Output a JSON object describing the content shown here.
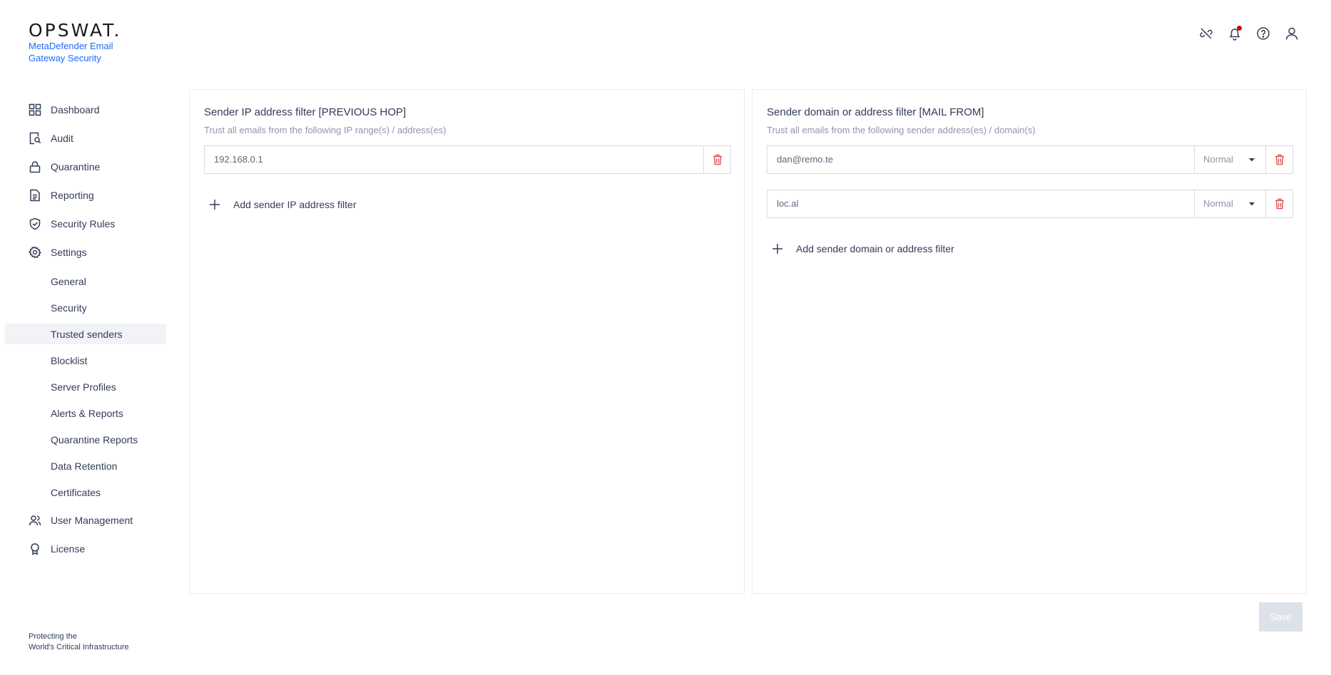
{
  "brand": {
    "logo": "OPSWAT.",
    "product": "MetaDefender Email Gateway Security",
    "footer_line1": "Protecting the",
    "footer_line2": "World's Critical Infrastructure"
  },
  "sidebar": {
    "items": [
      {
        "label": "Dashboard",
        "icon": "dashboard-icon"
      },
      {
        "label": "Audit",
        "icon": "audit-icon"
      },
      {
        "label": "Quarantine",
        "icon": "lock-icon"
      },
      {
        "label": "Reporting",
        "icon": "document-icon"
      },
      {
        "label": "Security Rules",
        "icon": "shield-check-icon"
      },
      {
        "label": "Settings",
        "icon": "gear-icon"
      }
    ],
    "settings_sub": [
      {
        "label": "General"
      },
      {
        "label": "Security"
      },
      {
        "label": "Trusted senders",
        "active": true
      },
      {
        "label": "Blocklist"
      },
      {
        "label": "Server Profiles"
      },
      {
        "label": "Alerts & Reports"
      },
      {
        "label": "Quarantine Reports"
      },
      {
        "label": "Data Retention"
      },
      {
        "label": "Certificates"
      }
    ],
    "bottom_items": [
      {
        "label": "User Management",
        "icon": "users-icon"
      },
      {
        "label": "License",
        "icon": "badge-icon"
      }
    ]
  },
  "header": {
    "icons": [
      "unlink-icon",
      "bell-icon",
      "help-icon",
      "user-icon"
    ],
    "notification_color": "#d00300"
  },
  "ip_panel": {
    "title": "Sender IP address filter [PREVIOUS HOP]",
    "subtitle": "Trust all emails from the following IP range(s) / address(es)",
    "entries": [
      {
        "value": "192.168.0.1"
      }
    ],
    "add_label": "Add sender IP address filter"
  },
  "domain_panel": {
    "title": "Sender domain or address filter [MAIL FROM]",
    "subtitle": "Trust all emails from the following sender address(es) / domain(s)",
    "entries": [
      {
        "value": "dan@remo.te",
        "mode": "Normal"
      },
      {
        "value": "loc.al",
        "mode": "Normal"
      }
    ],
    "add_label": "Add sender domain or address filter"
  },
  "actions": {
    "save_label": "Save"
  },
  "colors": {
    "accent": "#1d6bfc",
    "danger": "#e0524f",
    "active_bg": "#f1f3f6"
  }
}
